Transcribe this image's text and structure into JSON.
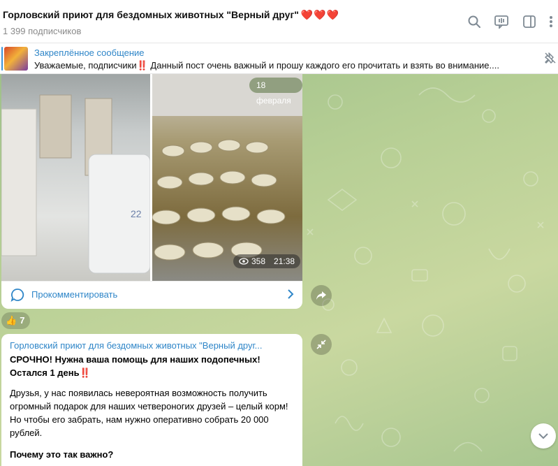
{
  "header": {
    "title": "Горловский приют для бездомных животных \"Верный друг\"",
    "hearts": "❤️❤️❤️",
    "subscribers": "1 399 подписчиков",
    "icons": [
      "search-icon",
      "video-chat-icon",
      "sidebar-toggle-icon",
      "more-icon"
    ]
  },
  "pinned": {
    "title": "Закреплённое сообщение",
    "text_before": "Уважаемые, подписчики",
    "exclamation": "‼️",
    "text_after": " Данный пост очень важный и прошу каждого его прочитать и взять во внимание...."
  },
  "message1": {
    "date": "18 февраля",
    "views": "358",
    "time": "21:38",
    "comment_label": "Прокомментировать",
    "reaction_emoji": "👍",
    "reaction_count": "7"
  },
  "message2": {
    "sender": "Горловский приют для бездомных животных \"Верный друг...",
    "headline1": "СРОЧНО! Нужна ваша помощь для наших подопечных!",
    "headline2": "Остался 1 день",
    "exclamation": "‼️",
    "paragraph": "Друзья, у нас появилась невероятная возможность получить огромный подарок для наших четвероногих друзей – целый корм! Но чтобы его забрать, нам нужно оперативно собрать 20 000 рублей.",
    "question": "Почему это так важно?"
  },
  "colors": {
    "accent": "#2f86c8",
    "heart": "#e0245e",
    "alert": "#d2222d"
  }
}
